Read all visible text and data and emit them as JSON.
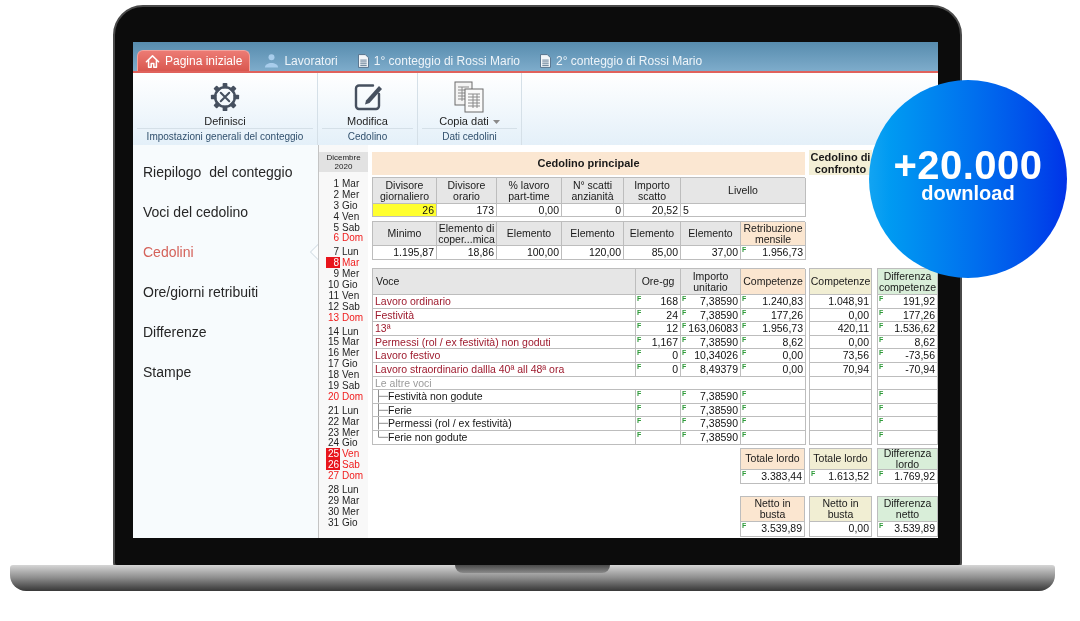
{
  "badge": {
    "headline": "+20.000",
    "caption": "download"
  },
  "tabs": [
    {
      "label": "Pagina iniziale",
      "kind": "start",
      "selected": true
    },
    {
      "label": "Lavoratori",
      "kind": "people",
      "selected": false
    },
    {
      "label": "1° conteggio di Rossi Mario",
      "kind": "document",
      "selected": false
    },
    {
      "label": "2° conteggio di Rossi Mario",
      "kind": "document",
      "selected": false
    }
  ],
  "ribbon": {
    "groups": [
      {
        "label": "Impostazioni generali del conteggio",
        "button": {
          "label": "Definisci",
          "kind": "settings"
        }
      },
      {
        "label": "Cedolino",
        "button": {
          "label": "Modifica",
          "kind": "edit"
        }
      },
      {
        "label": "Dati cedolini",
        "button": {
          "label": "Copia dati",
          "kind": "copy",
          "dropdown": true
        }
      }
    ]
  },
  "sidebar": {
    "items": [
      {
        "label": "Riepilogo  del conteggio",
        "selected": false
      },
      {
        "label": "Voci del cedolino",
        "selected": false
      },
      {
        "label": "Cedolini",
        "selected": true
      },
      {
        "label": "Ore/giorni retribuiti",
        "selected": false
      },
      {
        "label": "Differenze",
        "selected": false
      },
      {
        "label": "Stampe",
        "selected": false
      }
    ]
  },
  "calendar": {
    "title": "Dicembre 2020",
    "weeks": [
      {
        "days": [
          {
            "day": "1",
            "weekday": "Mar",
            "kind": "weekday"
          },
          {
            "day": "2",
            "weekday": "Mer",
            "kind": "weekday"
          },
          {
            "day": "3",
            "weekday": "Gio",
            "kind": "weekday"
          },
          {
            "day": "4",
            "weekday": "Ven",
            "kind": "weekday"
          },
          {
            "day": "5",
            "weekday": "Sab",
            "kind": "weekday"
          },
          {
            "day": "6",
            "weekday": "Dom",
            "kind": "sunday"
          }
        ]
      },
      {
        "days": [
          {
            "day": "7",
            "weekday": "Lun",
            "kind": "weekday"
          },
          {
            "day": "8",
            "weekday": "Mar",
            "kind": "holiday"
          },
          {
            "day": "9",
            "weekday": "Mer",
            "kind": "weekday"
          },
          {
            "day": "10",
            "weekday": "Gio",
            "kind": "weekday"
          },
          {
            "day": "11",
            "weekday": "Ven",
            "kind": "weekday"
          },
          {
            "day": "12",
            "weekday": "Sab",
            "kind": "weekday"
          },
          {
            "day": "13",
            "weekday": "Dom",
            "kind": "sunday"
          }
        ]
      },
      {
        "days": [
          {
            "day": "14",
            "weekday": "Lun",
            "kind": "weekday"
          },
          {
            "day": "15",
            "weekday": "Mar",
            "kind": "weekday"
          },
          {
            "day": "16",
            "weekday": "Mer",
            "kind": "weekday"
          },
          {
            "day": "17",
            "weekday": "Gio",
            "kind": "weekday"
          },
          {
            "day": "18",
            "weekday": "Ven",
            "kind": "weekday"
          },
          {
            "day": "19",
            "weekday": "Sab",
            "kind": "weekday"
          },
          {
            "day": "20",
            "weekday": "Dom",
            "kind": "sunday"
          }
        ]
      },
      {
        "days": [
          {
            "day": "21",
            "weekday": "Lun",
            "kind": "weekday"
          },
          {
            "day": "22",
            "weekday": "Mar",
            "kind": "weekday"
          },
          {
            "day": "23",
            "weekday": "Mer",
            "kind": "weekday"
          },
          {
            "day": "24",
            "weekday": "Gio",
            "kind": "weekday"
          },
          {
            "day": "25",
            "weekday": "Ven",
            "kind": "holiday"
          },
          {
            "day": "26",
            "weekday": "Sab",
            "kind": "holiday"
          },
          {
            "day": "27",
            "weekday": "Dom",
            "kind": "sunday"
          }
        ]
      },
      {
        "days": [
          {
            "day": "28",
            "weekday": "Lun",
            "kind": "weekday"
          },
          {
            "day": "29",
            "weekday": "Mar",
            "kind": "weekday"
          },
          {
            "day": "30",
            "weekday": "Mer",
            "kind": "weekday"
          },
          {
            "day": "31",
            "weekday": "Gio",
            "kind": "weekday"
          }
        ]
      }
    ]
  },
  "principale": {
    "title": "Cedolino principale",
    "parametri": {
      "columns": [
        "Divisore giornaliero",
        "Divisore orario",
        "% lavoro part-time",
        "N° scatti anzianità",
        "Importo scatto",
        "Livello"
      ],
      "values": [
        {
          "value": "26",
          "selected": true
        },
        {
          "value": "173",
          "selected": false
        },
        {
          "value": "0,00",
          "selected": false
        },
        {
          "value": "0",
          "selected": false
        },
        {
          "value": "20,52",
          "selected": false
        },
        {
          "value": "5",
          "selected": false
        }
      ]
    },
    "elementi": {
      "columns": [
        {
          "label": "Minimo",
          "kind": "plain"
        },
        {
          "label": "Elemento di coper...mica",
          "kind": "plain"
        },
        {
          "label": "Elemento",
          "kind": "plain"
        },
        {
          "label": "Elemento",
          "kind": "plain"
        },
        {
          "label": "Elemento",
          "kind": "plain"
        },
        {
          "label": "Elemento",
          "kind": "plain"
        },
        {
          "label": "Retribuzione mensile",
          "kind": "total"
        }
      ],
      "values": [
        {
          "value": "1.195,87"
        },
        {
          "value": "18,86"
        },
        {
          "value": "100,00"
        },
        {
          "value": "120,00"
        },
        {
          "value": "85,00"
        },
        {
          "value": "37,00"
        },
        {
          "flag": "F",
          "value": "1.956,73"
        }
      ]
    },
    "voci": {
      "columns": [
        {
          "label": "Voce",
          "kind": "text"
        },
        {
          "label": "Ore-gg",
          "kind": "number"
        },
        {
          "label": "Importo unitario",
          "kind": "number"
        },
        {
          "label": "Competenze",
          "kind": "total"
        }
      ],
      "rows": [
        {
          "kind": "voce",
          "voce": "Lavoro ordinario",
          "ore_gg": {
            "flag": "F",
            "value": "168"
          },
          "importo_unitario": {
            "flag": "F",
            "value": "7,38590"
          },
          "competenze": {
            "flag": "F",
            "value": "1.240,83"
          },
          "confronto": "1.048,91",
          "differenza": {
            "flag": "F",
            "value": "191,92"
          }
        },
        {
          "kind": "voce",
          "voce": "Festività",
          "ore_gg": {
            "flag": "F",
            "value": "24"
          },
          "importo_unitario": {
            "flag": "F",
            "value": "7,38590"
          },
          "competenze": {
            "flag": "F",
            "value": "177,26"
          },
          "confronto": "0,00",
          "differenza": {
            "flag": "F",
            "value": "177,26"
          }
        },
        {
          "kind": "voce",
          "voce": "13ª",
          "ore_gg": {
            "flag": "F",
            "value": "12"
          },
          "importo_unitario": {
            "flag": "F",
            "value": "163,06083"
          },
          "competenze": {
            "flag": "F",
            "value": "1.956,73"
          },
          "confronto": "420,11",
          "differenza": {
            "flag": "F",
            "value": "1.536,62"
          }
        },
        {
          "kind": "voce",
          "voce": "Permessi (rol / ex festività) non goduti",
          "ore_gg": {
            "flag": "F",
            "value": "1,167"
          },
          "importo_unitario": {
            "flag": "F",
            "value": "7,38590"
          },
          "competenze": {
            "flag": "F",
            "value": "8,62"
          },
          "confronto": "0,00",
          "differenza": {
            "flag": "F",
            "value": "8,62"
          }
        },
        {
          "kind": "voce",
          "voce": "Lavoro festivo",
          "ore_gg": {
            "flag": "F",
            "value": "0"
          },
          "importo_unitario": {
            "flag": "F",
            "value": "10,34026"
          },
          "competenze": {
            "flag": "F",
            "value": "0,00"
          },
          "confronto": "73,56",
          "differenza": {
            "flag": "F",
            "value": "-73,56"
          }
        },
        {
          "kind": "voce",
          "voce": "Lavoro straordinario dallla 40ª all 48ª ora",
          "ore_gg": {
            "flag": "F",
            "value": "0"
          },
          "importo_unitario": {
            "flag": "F",
            "value": "8,49379"
          },
          "competenze": {
            "flag": "F",
            "value": "0,00"
          },
          "confronto": "70,94",
          "differenza": {
            "flag": "F",
            "value": "-70,94"
          }
        },
        {
          "kind": "group",
          "voce": "Le altre voci",
          "children": [
            {
              "kind": "altra",
              "voce": "Festività non godute",
              "ore_gg": {
                "flag": "F"
              },
              "importo_unitario": {
                "flag": "F",
                "value": "7,38590"
              },
              "competenze": {
                "flag": "F"
              },
              "differenza": {
                "flag": "F"
              }
            },
            {
              "kind": "altra",
              "voce": "Ferie",
              "ore_gg": {
                "flag": "F"
              },
              "importo_unitario": {
                "flag": "F",
                "value": "7,38590"
              },
              "competenze": {
                "flag": "F"
              },
              "differenza": {
                "flag": "F"
              }
            },
            {
              "kind": "altra",
              "voce": "Permessi (rol / ex festività)",
              "ore_gg": {
                "flag": "F"
              },
              "importo_unitario": {
                "flag": "F",
                "value": "7,38590"
              },
              "competenze": {
                "flag": "F"
              },
              "differenza": {
                "flag": "F"
              }
            },
            {
              "kind": "altra",
              "voce": "Ferie non godute",
              "ore_gg": {
                "flag": "F"
              },
              "importo_unitario": {
                "flag": "F",
                "value": "7,38590"
              },
              "competenze": {
                "flag": "F"
              },
              "differenza": {
                "flag": "F"
              }
            }
          ]
        }
      ]
    },
    "totale_lordo": {
      "label": "Totale lordo",
      "flag": "F",
      "value": "3.383,44"
    },
    "netto": {
      "label": "Netto in busta",
      "flag": "F",
      "value": "3.539,89"
    }
  },
  "confronto": {
    "title": "Cedolino di confronto",
    "column": "Competenze",
    "totale_lordo": {
      "label": "Totale lordo",
      "flag": "F",
      "value": "1.613,52"
    },
    "netto": {
      "label": "Netto in busta",
      "value": "0,00"
    }
  },
  "differenza": {
    "column": "Differenza competenze",
    "totale_lordo": {
      "label": "Differenza lordo",
      "flag": "F",
      "value": "1.769,92"
    },
    "netto": {
      "label": "Differenza netto",
      "flag": "F",
      "value": "3.539,89"
    }
  }
}
